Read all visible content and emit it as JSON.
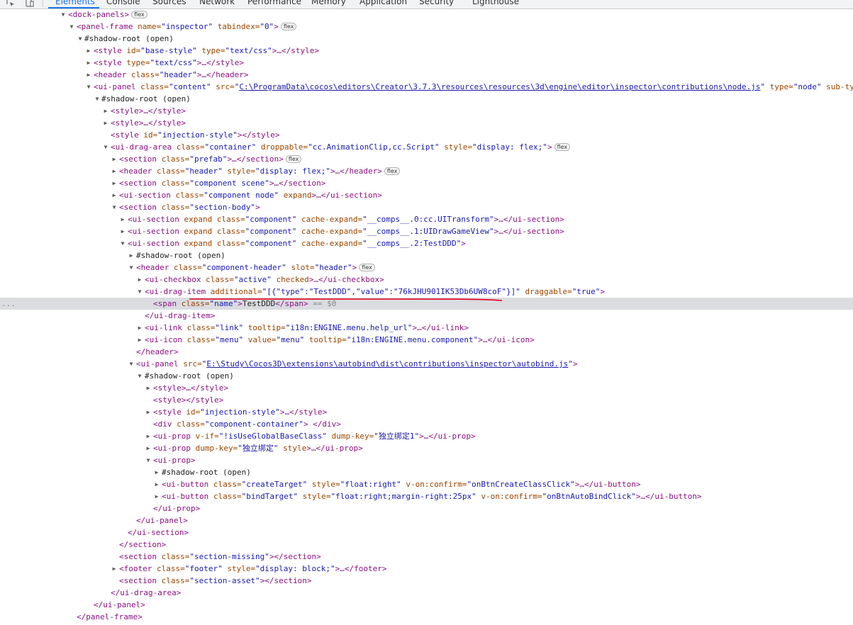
{
  "toolbar": {
    "tabs": [
      "Elements",
      "Console",
      "Sources",
      "Network",
      "Performance",
      "Memory",
      "Application",
      "Security",
      "Lighthouse"
    ],
    "active_tab": "Elements",
    "badge_label": "flex",
    "selected_marker": "...",
    "dollar_zero": "== $0"
  },
  "lines": {
    "l0_tag": "<dock-panels>",
    "l1_a": "<panel-frame",
    "l1_an1": " name=",
    "l1_av1": "\"inspector\"",
    "l1_an2": " tabindex=",
    "l1_av2": "\"0\"",
    "l1_b": ">",
    "l2": "#shadow-root (open)",
    "l3_a": "<style",
    "l3_an1": " id=",
    "l3_av1": "\"base-style\"",
    "l3_an2": " type=",
    "l3_av2": "\"text/css\"",
    "l3_b": ">…</style>",
    "l4_a": "<style",
    "l4_an1": " type=",
    "l4_av1": "\"text/css\"",
    "l4_b": ">…</style>",
    "l5_a": "<header",
    "l5_an1": " class=",
    "l5_av1": "\"header\"",
    "l5_b": ">…</header>",
    "l6_a": "<ui-panel",
    "l6_an1": " class=",
    "l6_av1": "\"content\"",
    "l6_an2": " src=",
    "l6_q1": "\"",
    "l6_link": "C:\\ProgramData\\cocos\\editors\\Creator\\3.7.3\\resources\\resources\\3d\\engine\\editor\\inspector\\contributions\\node.js",
    "l6_q2": "\"",
    "l6_an3": " type=",
    "l6_av3": "\"node\"",
    "l6_an4": " sub-type",
    "l7": "#shadow-root (open)",
    "l8": "<style>…</style>",
    "l9": "<style>…</style>",
    "l10_a": "<style",
    "l10_an1": " id=",
    "l10_av1": "\"injection-style\"",
    "l10_b": "></style>",
    "l11_a": "<ui-drag-area",
    "l11_an1": " class=",
    "l11_av1": "\"container\"",
    "l11_an2": " droppable=",
    "l11_av2": "\"cc.AnimationClip,cc.Script\"",
    "l11_an3": " style=",
    "l11_av3": "\"display: flex;\"",
    "l11_b": ">",
    "l12_a": "<section",
    "l12_an1": " class=",
    "l12_av1": "\"prefab\"",
    "l12_b": ">…</section>",
    "l13_a": "<header",
    "l13_an1": " class=",
    "l13_av1": "\"header\"",
    "l13_an2": " style=",
    "l13_av2": "\"display: flex;\"",
    "l13_b": ">…</header>",
    "l14_a": "<section",
    "l14_an1": " class=",
    "l14_av1": "\"component scene\"",
    "l14_b": ">…</section>",
    "l15_a": "<ui-section",
    "l15_an1": " class=",
    "l15_av1": "\"component node\"",
    "l15_an2": " expand",
    "l15_b": ">…</ui-section>",
    "l16_a": "<section",
    "l16_an1": " class=",
    "l16_av1": "\"section-body\"",
    "l16_b": ">",
    "l17_a": "<ui-section",
    "l17_an1": " expand class=",
    "l17_av1": "\"component\"",
    "l17_an2": " cache-expand=",
    "l17_av2": "\"__comps__.0:cc.UITransform\"",
    "l17_b": ">…</ui-section>",
    "l18_a": "<ui-section",
    "l18_an1": " expand class=",
    "l18_av1": "\"component\"",
    "l18_an2": " cache-expand=",
    "l18_av2": "\"__comps__.1:UIDrawGameView\"",
    "l18_b": ">…</ui-section>",
    "l19_a": "<ui-section",
    "l19_an1": " expand class=",
    "l19_av1": "\"component\"",
    "l19_an2": " cache-expand=",
    "l19_av2": "\"__comps__.2:TestDDD\"",
    "l19_b": ">",
    "l20": "#shadow-root (open)",
    "l21_a": "<header",
    "l21_an1": " class=",
    "l21_av1": "\"component-header\"",
    "l21_an2": " slot=",
    "l21_av2": "\"header\"",
    "l21_b": ">",
    "l22_a": "<ui-checkbox",
    "l22_an1": " class=",
    "l22_av1": "\"active\"",
    "l22_an2": " checked",
    "l22_b": ">…</ui-checkbox>",
    "l23_a": "<ui-drag-item",
    "l23_an1": " additional=",
    "l23_av1": "\"[{\"type\":\"TestDDD\",\"value\":\"76kJHU901IK53Db6UW8coF\"}]\"",
    "l23_an2": " draggable=",
    "l23_av2": "\"true\"",
    "l23_b": ">",
    "l24_a": "<span",
    "l24_an1": " class=",
    "l24_av1": "\"name\"",
    "l24_b": ">",
    "l24_text": "TestDDD",
    "l24_c": "</span>",
    "l25": "</ui-drag-item>",
    "l26_a": "<ui-link",
    "l26_an1": " class=",
    "l26_av1": "\"link\"",
    "l26_an2": " tooltip=",
    "l26_av2": "\"i18n:ENGINE.menu.help_url\"",
    "l26_b": ">…</ui-link>",
    "l27_a": "<ui-icon",
    "l27_an1": " class=",
    "l27_av1": "\"menu\"",
    "l27_an2": " value=",
    "l27_av2": "\"menu\"",
    "l27_an3": " tooltip=",
    "l27_av3": "\"i18n:ENGINE.menu.component\"",
    "l27_b": ">…</ui-icon>",
    "l28": "</header>",
    "l29_a": "<ui-panel",
    "l29_an1": " src=",
    "l29_q1": "\"",
    "l29_link": "E:\\Study\\Cocos3D\\extensions\\autobind\\dist\\contributions\\inspector\\autobind.js",
    "l29_q2": "\"",
    "l29_b": ">",
    "l30": "#shadow-root (open)",
    "l31": "<style>…</style>",
    "l32": "<style></style>",
    "l33_a": "<style",
    "l33_an1": " id=",
    "l33_av1": "\"injection-style\"",
    "l33_b": ">…</style>",
    "l34_a": "<div",
    "l34_an1": " class=",
    "l34_av1": "\"component-container\"",
    "l34_b": "> </div>",
    "l35_a": "<ui-prop",
    "l35_an1": " v-if=",
    "l35_av1": "\"!isUseGlobalBaseClass\"",
    "l35_an2": " dump-key=",
    "l35_av2": "\"独立绑定1\"",
    "l35_b": ">…</ui-prop>",
    "l36_a": "<ui-prop",
    "l36_an1": " dump-key=",
    "l36_av1": "\"独立绑定\"",
    "l36_an2": " style",
    "l36_b": ">…</ui-prop>",
    "l37": "<ui-prop>",
    "l38": "#shadow-root (open)",
    "l39_a": "<ui-button",
    "l39_an1": " class=",
    "l39_av1": "\"createTarget\"",
    "l39_an2": " style=",
    "l39_av2": "\"float:right\"",
    "l39_an3": " v-on:confirm=",
    "l39_av3": "\"onBtnCreateClassClick\"",
    "l39_b": ">…</ui-button>",
    "l40_a": "<ui-button",
    "l40_an1": " class=",
    "l40_av1": "\"bindTarget\"",
    "l40_an2": " style=",
    "l40_av2": "\"float:right;margin-right:25px\"",
    "l40_an3": " v-on:confirm=",
    "l40_av3": "\"onBtnAutoBindClick\"",
    "l40_b": ">…</ui-button>",
    "l41": "</ui-prop>",
    "l42": "</ui-panel>",
    "l43": "</ui-section>",
    "l44": "</section>",
    "l45_a": "<section",
    "l45_an1": " class=",
    "l45_av1": "\"section-missing\"",
    "l45_b": "></section>",
    "l46_a": "<footer",
    "l46_an1": " class=",
    "l46_av1": "\"footer\"",
    "l46_an2": " style=",
    "l46_av2": "\"display: block;\"",
    "l46_b": ">…</footer>",
    "l47_a": "<section",
    "l47_an1": " class=",
    "l47_av1": "\"section-asset\"",
    "l47_b": "></section>",
    "l48": "</ui-drag-area>",
    "l49": "</ui-panel>",
    "l50": "</panel-frame>"
  },
  "colors": {
    "tag": "#881280",
    "attr_name": "#994500",
    "attr_value": "#1a1aa6",
    "selection": "#dadce0",
    "annotation_underline": "#e8001c",
    "active_tab": "#1a73e8"
  }
}
